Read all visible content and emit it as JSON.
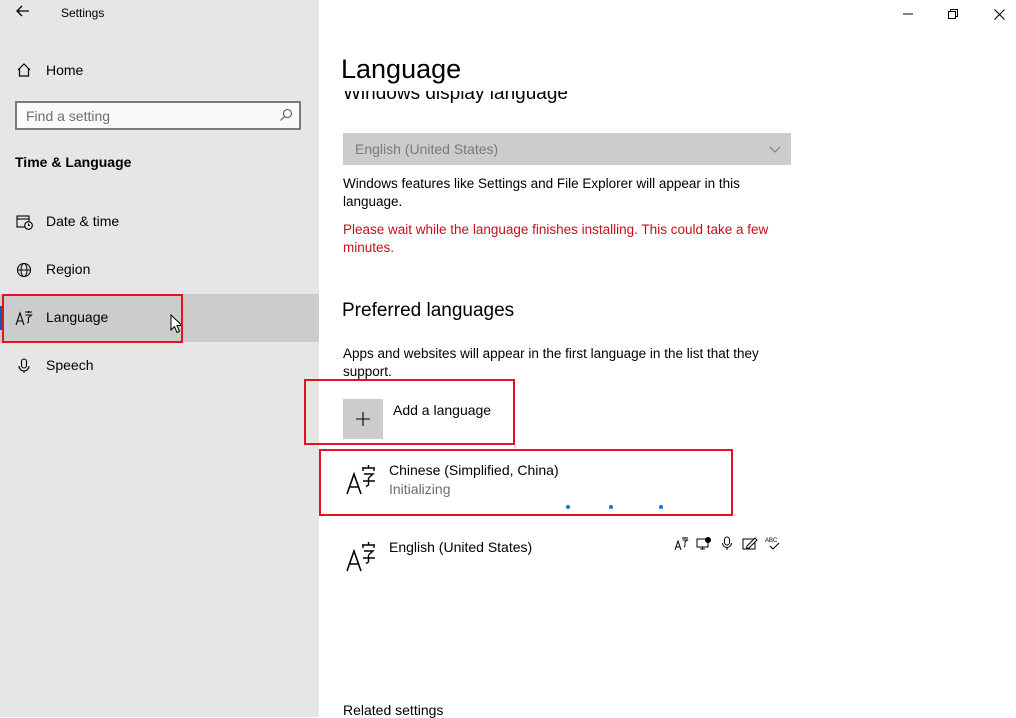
{
  "window": {
    "title": "Settings",
    "controls": {
      "minimize": "minimize-icon",
      "restore": "restore-icon",
      "close": "close-icon"
    }
  },
  "sidebar": {
    "home_label": "Home",
    "search": {
      "placeholder": "Find a setting",
      "value": ""
    },
    "section_title": "Time & Language",
    "items": [
      {
        "label": "Date & time",
        "icon": "calendar-clock-icon",
        "active": false
      },
      {
        "label": "Region",
        "icon": "globe-icon",
        "active": false
      },
      {
        "label": "Language",
        "icon": "language-icon",
        "active": true
      },
      {
        "label": "Speech",
        "icon": "microphone-icon",
        "active": false
      }
    ]
  },
  "main": {
    "page_title": "Language",
    "display_language": {
      "heading": "Windows display language",
      "selected": "English (United States)",
      "description": "Windows features like Settings and File Explorer will appear in this language.",
      "warning": "Please wait while the language finishes installing. This could take a few minutes."
    },
    "preferred": {
      "heading": "Preferred languages",
      "description": "Apps and websites will appear in the first language in the list that they support.",
      "add_label": "Add a language",
      "languages": [
        {
          "name": "Chinese (Simplified, China)",
          "status": "Initializing"
        },
        {
          "name": "English (United States)",
          "status": ""
        }
      ],
      "english_feature_icons": [
        "language-pack-icon",
        "text-to-speech-icon",
        "speech-recognition-icon",
        "handwriting-icon",
        "spellcheck-icon"
      ],
      "english_feature_abc": "ABC"
    },
    "related_settings": "Related settings"
  },
  "colors": {
    "sidebar_bg": "#e6e6e6",
    "active_item_bg": "#cccccc",
    "accent": "#0078d7",
    "warning_text": "#c50f1f",
    "highlight_box": "#e81123"
  }
}
